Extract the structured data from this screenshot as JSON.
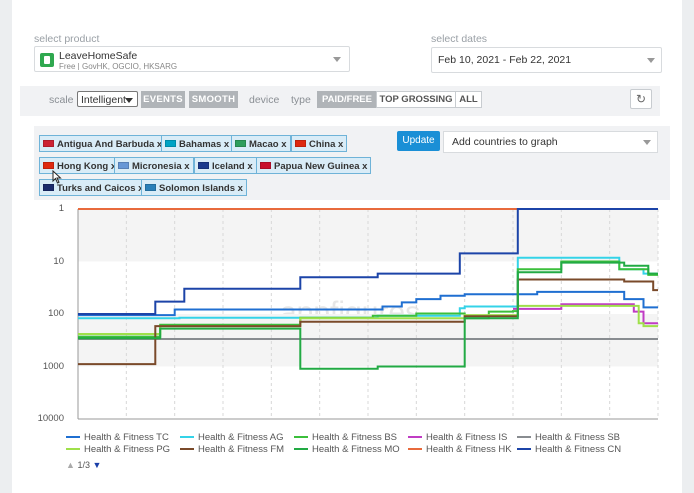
{
  "product": {
    "label": "select product",
    "name": "LeaveHomeSafe",
    "sub": "Free | GovHK, OGCIO, HKSARG",
    "icon": "app-icon"
  },
  "dates": {
    "label": "select dates",
    "value": "Feb 10, 2021 - Feb 22, 2021"
  },
  "toolbar": {
    "scale_label": "scale",
    "scale_value": "Intelligent",
    "events_label": "EVENTS",
    "smooth_label": "SMOOTH",
    "device_label": "device",
    "type_label": "type",
    "type_options": [
      "PAID/FREE",
      "TOP GROSSING",
      "ALL"
    ],
    "refresh_icon": "refresh-icon"
  },
  "countries": {
    "tags": [
      {
        "label": "Antigua And Barbuda x",
        "flag": "#cc2233"
      },
      {
        "label": "Bahamas x",
        "flag": "#00a3c4"
      },
      {
        "label": "Macao x",
        "flag": "#2f9e5c"
      },
      {
        "label": "China x",
        "flag": "#de2910"
      },
      {
        "label": "Hong Kong x",
        "flag": "#de2910"
      },
      {
        "label": "Micronesia x",
        "flag": "#6797d6"
      },
      {
        "label": "Iceland x",
        "flag": "#1b3a8c"
      },
      {
        "label": "Papua New Guinea x",
        "flag": "#c8102e"
      },
      {
        "label": "Turks and Caicos x",
        "flag": "#1b2a6b"
      },
      {
        "label": "Solomon Islands x",
        "flag": "#2a7fb8"
      }
    ],
    "update_label": "Update",
    "add_placeholder": "Add countries to graph"
  },
  "watermark": "appfigures",
  "chart_data": {
    "type": "line",
    "y_scale": "log-rank-inverted",
    "ylim": [
      1,
      10000
    ],
    "y_ticks": [
      "1",
      "10",
      "100",
      "1000",
      "10000"
    ],
    "x_range_days": [
      0,
      12
    ],
    "series": [
      {
        "name": "Health & Fitness TC",
        "color": "#1f6fd1",
        "points": [
          [
            0,
            105
          ],
          [
            1.9,
            105
          ],
          [
            2.0,
            82
          ],
          [
            4.5,
            82
          ],
          [
            4.6,
            82
          ],
          [
            6.0,
            82
          ],
          [
            6.3,
            72
          ],
          [
            6.7,
            60
          ],
          [
            7.0,
            52
          ],
          [
            7.5,
            45
          ],
          [
            8.0,
            42
          ],
          [
            9.0,
            42
          ],
          [
            9.5,
            38
          ],
          [
            10.5,
            38
          ],
          [
            11.3,
            52
          ],
          [
            11.5,
            52
          ],
          [
            11.7,
            75
          ],
          [
            12,
            75
          ]
        ]
      },
      {
        "name": "Health & Fitness AG",
        "color": "#34d3e8",
        "points": [
          [
            0,
            120
          ],
          [
            2.0,
            120
          ],
          [
            2.1,
            118
          ],
          [
            6.0,
            118
          ],
          [
            6.2,
            108
          ],
          [
            7.8,
            108
          ],
          [
            7.9,
            78
          ],
          [
            8.0,
            72
          ],
          [
            9.0,
            72
          ],
          [
            9.1,
            8.5
          ],
          [
            11.0,
            8.5
          ],
          [
            11.2,
            14
          ],
          [
            11.6,
            14
          ],
          [
            11.7,
            17
          ],
          [
            12,
            17
          ]
        ]
      },
      {
        "name": "Health & Fitness BS",
        "color": "#3bbf3b",
        "points": [
          [
            0,
            270
          ],
          [
            1.6,
            270
          ],
          [
            1.7,
            160
          ],
          [
            4.5,
            160
          ],
          [
            4.6,
            118
          ],
          [
            6.0,
            118
          ],
          [
            6.1,
            108
          ],
          [
            7.0,
            98
          ],
          [
            7.8,
            98
          ],
          [
            8.0,
            120
          ],
          [
            8.5,
            90
          ],
          [
            9.0,
            88
          ],
          [
            9.1,
            14
          ],
          [
            9.8,
            14
          ],
          [
            10.0,
            10
          ],
          [
            11.0,
            10
          ],
          [
            11.2,
            14
          ],
          [
            11.7,
            14
          ],
          [
            11.8,
            18
          ],
          [
            12,
            18
          ]
        ]
      },
      {
        "name": "Health & Fitness IS",
        "color": "#c03cc4",
        "points": [
          [
            9.0,
            80
          ],
          [
            9.5,
            80
          ],
          [
            10.0,
            65
          ],
          [
            11.0,
            65
          ],
          [
            11.5,
            90
          ],
          [
            11.7,
            150
          ],
          [
            12,
            150
          ]
        ]
      },
      {
        "name": "Health & Fitness SB",
        "color": "#888c90",
        "points": [
          [
            0,
            300
          ],
          [
            12,
            300
          ]
        ]
      },
      {
        "name": "Health & Fitness PG",
        "color": "#9fe04a",
        "points": [
          [
            0,
            240
          ],
          [
            1.6,
            240
          ],
          [
            1.7,
            170
          ],
          [
            4.5,
            170
          ],
          [
            4.6,
            120
          ],
          [
            7.8,
            120
          ],
          [
            8.0,
            105
          ],
          [
            9.0,
            105
          ],
          [
            9.1,
            70
          ],
          [
            11.0,
            70
          ],
          [
            11.3,
            70
          ],
          [
            11.6,
            150
          ],
          [
            11.7,
            170
          ],
          [
            12,
            170
          ]
        ]
      },
      {
        "name": "Health & Fitness FM",
        "color": "#7a4a2a",
        "points": [
          [
            0,
            900
          ],
          [
            1.5,
            900
          ],
          [
            1.6,
            170
          ],
          [
            4.5,
            170
          ],
          [
            4.6,
            140
          ],
          [
            7.8,
            140
          ],
          [
            8.0,
            110
          ],
          [
            9.0,
            110
          ],
          [
            9.1,
            22
          ],
          [
            11.0,
            22
          ],
          [
            11.3,
            24
          ],
          [
            11.7,
            24
          ],
          [
            11.9,
            35
          ],
          [
            12,
            35
          ]
        ]
      },
      {
        "name": "Health & Fitness MO",
        "color": "#22aa44",
        "points": [
          [
            0,
            290
          ],
          [
            1.6,
            290
          ],
          [
            1.7,
            190
          ],
          [
            4.5,
            190
          ],
          [
            4.6,
            1100
          ],
          [
            6.0,
            1100
          ],
          [
            6.2,
            1000
          ],
          [
            7.8,
            1000
          ],
          [
            8.0,
            120
          ],
          [
            9.0,
            120
          ],
          [
            9.1,
            16
          ],
          [
            9.8,
            16
          ],
          [
            10.0,
            10.5
          ],
          [
            11.0,
            10.5
          ],
          [
            11.3,
            12
          ],
          [
            11.7,
            12
          ],
          [
            11.8,
            17
          ],
          [
            12,
            17
          ]
        ]
      },
      {
        "name": "Health & Fitness HK",
        "color": "#e86a3c",
        "points": [
          [
            0,
            1
          ],
          [
            12,
            1
          ]
        ]
      },
      {
        "name": "Health & Fitness CN",
        "color": "#1c44a8",
        "points": [
          [
            0,
            100
          ],
          [
            1.5,
            100
          ],
          [
            1.6,
            58
          ],
          [
            2.1,
            58
          ],
          [
            2.2,
            33
          ],
          [
            4.5,
            33
          ],
          [
            4.6,
            20
          ],
          [
            6.0,
            20
          ],
          [
            6.2,
            17
          ],
          [
            7.8,
            17
          ],
          [
            7.9,
            7
          ],
          [
            9.0,
            7
          ],
          [
            9.1,
            1
          ],
          [
            12,
            1
          ]
        ]
      }
    ],
    "legend": [
      "Health & Fitness TC",
      "Health & Fitness AG",
      "Health & Fitness BS",
      "Health & Fitness IS",
      "Health & Fitness SB",
      "Health & Fitness PG",
      "Health & Fitness FM",
      "Health & Fitness MO",
      "Health & Fitness HK",
      "Health & Fitness CN"
    ],
    "legend_page": "1/3"
  }
}
